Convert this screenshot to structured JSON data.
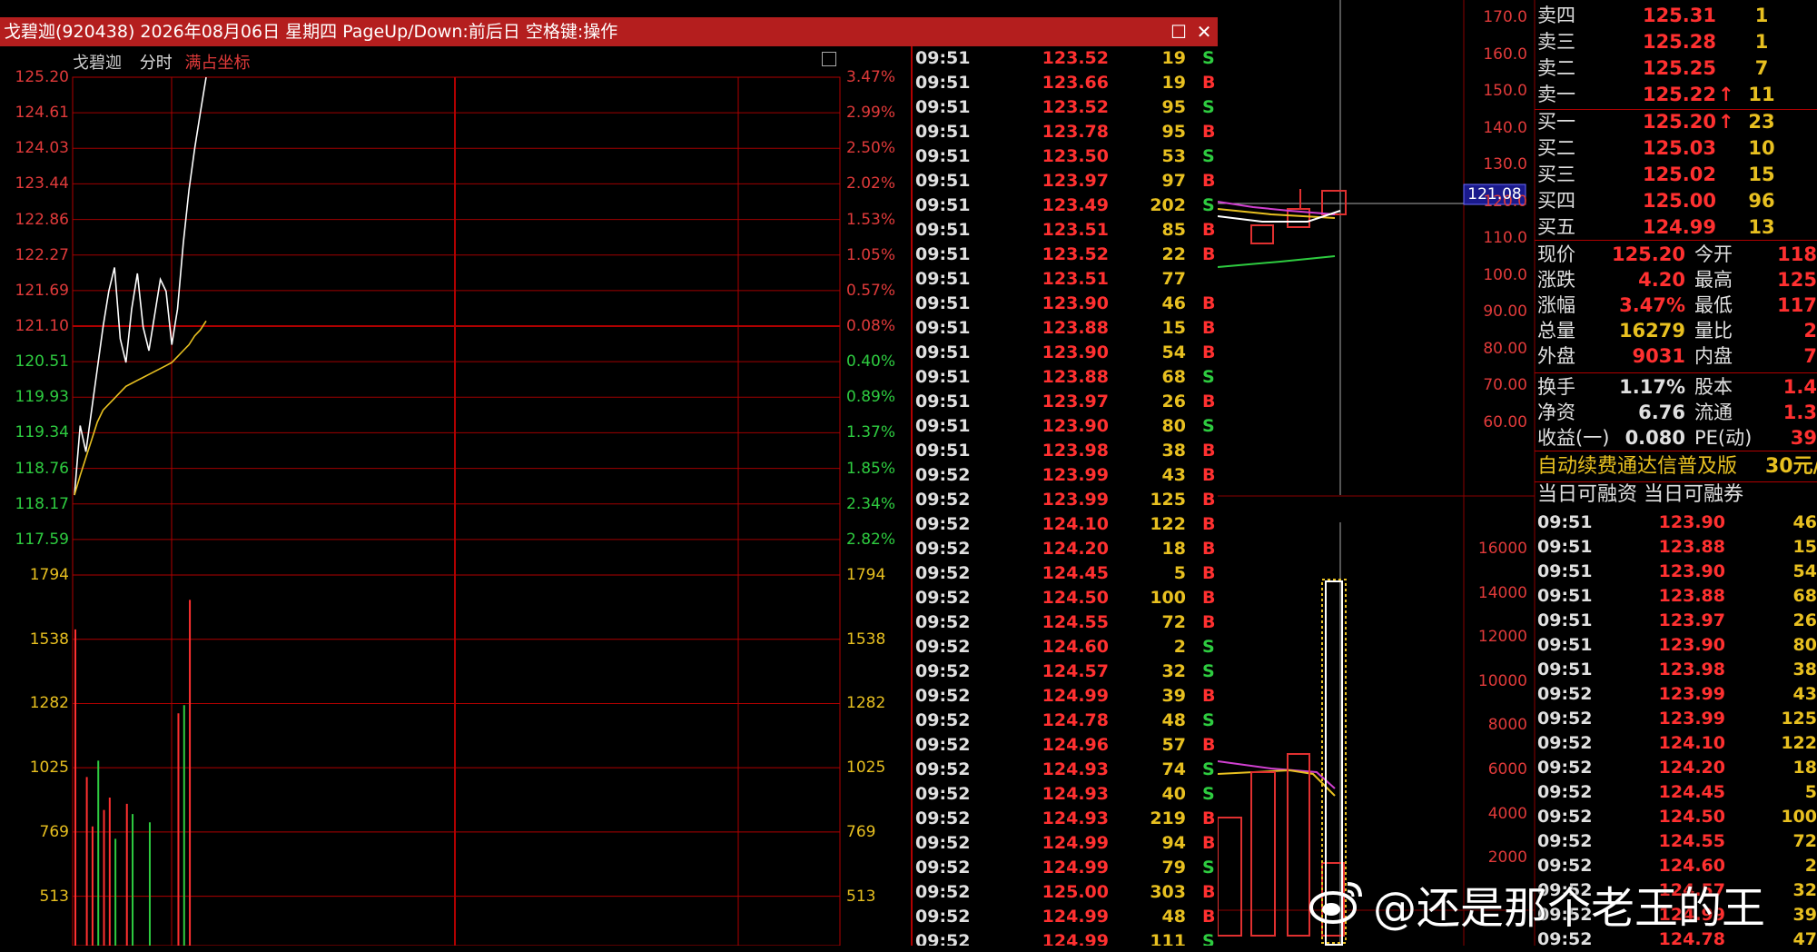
{
  "window": {
    "title": "戈碧迦(920438) 2026年08月06日 星期四 PageUp/Down:前后日 空格键:操作",
    "maximize_icon": "maximize-icon",
    "close_icon": "close-icon"
  },
  "chart_header": {
    "stock_name": "戈碧迦",
    "period": "分时",
    "mode": "满占坐标"
  },
  "price_ticks": [
    "125.20",
    "124.61",
    "124.03",
    "123.44",
    "122.86",
    "122.27",
    "121.69",
    "121.10",
    "120.51",
    "119.93",
    "119.34",
    "118.76",
    "118.17",
    "117.59"
  ],
  "pct_ticks": [
    "3.47%",
    "2.99%",
    "2.50%",
    "2.02%",
    "1.53%",
    "1.05%",
    "0.57%",
    "0.08%",
    "0.40%",
    "0.89%",
    "1.37%",
    "1.85%",
    "2.34%",
    "2.82%"
  ],
  "volume_ticks": [
    "1794",
    "1538",
    "1282",
    "1025",
    "769",
    "513"
  ],
  "right_axis_top": [
    "170.0",
    "160.0",
    "150.0",
    "140.0",
    "130.0",
    "120.0",
    "110.0",
    "100.0",
    "90.00",
    "80.00",
    "70.00",
    "60.00"
  ],
  "right_axis_bottom": [
    "16000",
    "14000",
    "12000",
    "10000",
    "8000",
    "6000",
    "4000",
    "2000"
  ],
  "crosshair_price": "121.08",
  "chart_data": {
    "type": "line",
    "title": "",
    "xlabel": "",
    "ylabel": "",
    "ylim": [
      117.59,
      125.2
    ],
    "series": [
      {
        "name": "",
        "color": "#ffffff",
        "values": [
          118.17,
          119.34,
          118.9,
          119.6,
          120.3,
          121.0,
          121.6,
          122.0,
          120.8,
          120.4,
          121.3,
          121.9,
          121.0,
          120.6,
          121.2,
          121.8,
          121.6,
          120.7,
          121.3,
          122.4,
          123.3,
          124.0,
          124.61,
          125.2
        ]
      },
      {
        "name": "",
        "color": "#e8c020",
        "values": [
          118.17,
          118.5,
          118.8,
          119.1,
          119.4,
          119.6,
          119.7,
          119.8,
          119.9,
          120.0,
          120.05,
          120.1,
          120.15,
          120.2,
          120.25,
          120.3,
          120.35,
          120.4,
          120.5,
          120.6,
          120.7,
          120.85,
          120.95,
          121.1
        ]
      }
    ],
    "volumes": [
      1538,
      0,
      820,
      580,
      900,
      660,
      720,
      520,
      0,
      690,
      640,
      0,
      0,
      600,
      0,
      0,
      0,
      0,
      1130,
      1170,
      1682
    ]
  },
  "trades_popup": [
    {
      "time": "09:51",
      "price": "123.52",
      "vol": "19",
      "side": "S"
    },
    {
      "time": "09:51",
      "price": "123.66",
      "vol": "19",
      "side": "B"
    },
    {
      "time": "09:51",
      "price": "123.52",
      "vol": "95",
      "side": "S"
    },
    {
      "time": "09:51",
      "price": "123.78",
      "vol": "95",
      "side": "B"
    },
    {
      "time": "09:51",
      "price": "123.50",
      "vol": "53",
      "side": "S"
    },
    {
      "time": "09:51",
      "price": "123.97",
      "vol": "97",
      "side": "B"
    },
    {
      "time": "09:51",
      "price": "123.49",
      "vol": "202",
      "side": "S"
    },
    {
      "time": "09:51",
      "price": "123.51",
      "vol": "85",
      "side": "B"
    },
    {
      "time": "09:51",
      "price": "123.52",
      "vol": "22",
      "side": "B"
    },
    {
      "time": "09:51",
      "price": "123.51",
      "vol": "77",
      "side": ""
    },
    {
      "time": "09:51",
      "price": "123.90",
      "vol": "46",
      "side": "B"
    },
    {
      "time": "09:51",
      "price": "123.88",
      "vol": "15",
      "side": "B"
    },
    {
      "time": "09:51",
      "price": "123.90",
      "vol": "54",
      "side": "B"
    },
    {
      "time": "09:51",
      "price": "123.88",
      "vol": "68",
      "side": "S"
    },
    {
      "time": "09:51",
      "price": "123.97",
      "vol": "26",
      "side": "B"
    },
    {
      "time": "09:51",
      "price": "123.90",
      "vol": "80",
      "side": "S"
    },
    {
      "time": "09:51",
      "price": "123.98",
      "vol": "38",
      "side": "B"
    },
    {
      "time": "09:52",
      "price": "123.99",
      "vol": "43",
      "side": "B"
    },
    {
      "time": "09:52",
      "price": "123.99",
      "vol": "125",
      "side": "B"
    },
    {
      "time": "09:52",
      "price": "124.10",
      "vol": "122",
      "side": "B"
    },
    {
      "time": "09:52",
      "price": "124.20",
      "vol": "18",
      "side": "B"
    },
    {
      "time": "09:52",
      "price": "124.45",
      "vol": "5",
      "side": "B"
    },
    {
      "time": "09:52",
      "price": "124.50",
      "vol": "100",
      "side": "B"
    },
    {
      "time": "09:52",
      "price": "124.55",
      "vol": "72",
      "side": "B"
    },
    {
      "time": "09:52",
      "price": "124.60",
      "vol": "2",
      "side": "S"
    },
    {
      "time": "09:52",
      "price": "124.57",
      "vol": "32",
      "side": "S"
    },
    {
      "time": "09:52",
      "price": "124.99",
      "vol": "39",
      "side": "B"
    },
    {
      "time": "09:52",
      "price": "124.78",
      "vol": "48",
      "side": "S"
    },
    {
      "time": "09:52",
      "price": "124.96",
      "vol": "57",
      "side": "B"
    },
    {
      "time": "09:52",
      "price": "124.93",
      "vol": "74",
      "side": "S"
    },
    {
      "time": "09:52",
      "price": "124.93",
      "vol": "40",
      "side": "S"
    },
    {
      "time": "09:52",
      "price": "124.93",
      "vol": "219",
      "side": "B"
    },
    {
      "time": "09:52",
      "price": "124.99",
      "vol": "94",
      "side": "B"
    },
    {
      "time": "09:52",
      "price": "124.99",
      "vol": "79",
      "side": "S"
    },
    {
      "time": "09:52",
      "price": "125.00",
      "vol": "303",
      "side": "B"
    },
    {
      "time": "09:52",
      "price": "124.99",
      "vol": "48",
      "side": "B"
    },
    {
      "time": "09:52",
      "price": "124.99",
      "vol": "111",
      "side": "S"
    }
  ],
  "order_book": [
    {
      "label": "卖四",
      "price": "125.31",
      "vol": "1",
      "arrow": ""
    },
    {
      "label": "卖三",
      "price": "125.28",
      "vol": "1",
      "arrow": ""
    },
    {
      "label": "卖二",
      "price": "125.25",
      "vol": "7",
      "arrow": ""
    },
    {
      "label": "卖一",
      "price": "125.22",
      "vol": "11",
      "arrow": "↑"
    },
    {
      "label": "买一",
      "price": "125.20",
      "vol": "23",
      "arrow": "↑"
    },
    {
      "label": "买二",
      "price": "125.03",
      "vol": "10",
      "arrow": ""
    },
    {
      "label": "买三",
      "price": "125.02",
      "vol": "15",
      "arrow": ""
    },
    {
      "label": "买四",
      "price": "125.00",
      "vol": "96",
      "arrow": ""
    },
    {
      "label": "买五",
      "price": "124.99",
      "vol": "13",
      "arrow": ""
    }
  ],
  "stock_info": [
    {
      "l1": "现价",
      "v1": "125.20",
      "c1": "red",
      "l2": "今开",
      "v2": "118"
    },
    {
      "l1": "涨跌",
      "v1": "4.20",
      "c1": "red",
      "l2": "最高",
      "v2": "125"
    },
    {
      "l1": "涨幅",
      "v1": "3.47%",
      "c1": "red",
      "l2": "最低",
      "v2": "117"
    },
    {
      "l1": "总量",
      "v1": "16279",
      "c1": "yel",
      "l2": "量比",
      "v2": "2"
    },
    {
      "l1": "外盘",
      "v1": "9031",
      "c1": "red",
      "l2": "内盘",
      "v2": "7"
    },
    {
      "l1": "换手",
      "v1": "1.17%",
      "c1": "wht",
      "l2": "股本",
      "v2": "1.4"
    },
    {
      "l1": "净资",
      "v1": "6.76",
      "c1": "wht",
      "l2": "流通",
      "v2": "1.3"
    },
    {
      "l1": "收益(一)",
      "v1": "0.080",
      "c1": "wht",
      "l2": "PE(动)",
      "v2": "39"
    }
  ],
  "promo": {
    "text": "自动续费通达信普及版",
    "price": "30元/"
  },
  "margin_line": "当日可融资 当日可融券",
  "trades_right": [
    {
      "time": "09:51",
      "price": "123.90",
      "vol": "46"
    },
    {
      "time": "09:51",
      "price": "123.88",
      "vol": "15"
    },
    {
      "time": "09:51",
      "price": "123.90",
      "vol": "54"
    },
    {
      "time": "09:51",
      "price": "123.88",
      "vol": "68"
    },
    {
      "time": "09:51",
      "price": "123.97",
      "vol": "26"
    },
    {
      "time": "09:51",
      "price": "123.90",
      "vol": "80"
    },
    {
      "time": "09:51",
      "price": "123.98",
      "vol": "38"
    },
    {
      "time": "09:52",
      "price": "123.99",
      "vol": "43"
    },
    {
      "time": "09:52",
      "price": "123.99",
      "vol": "125"
    },
    {
      "time": "09:52",
      "price": "124.10",
      "vol": "122"
    },
    {
      "time": "09:52",
      "price": "124.20",
      "vol": "18"
    },
    {
      "time": "09:52",
      "price": "124.45",
      "vol": "5"
    },
    {
      "time": "09:52",
      "price": "124.50",
      "vol": "100"
    },
    {
      "time": "09:52",
      "price": "124.55",
      "vol": "72"
    },
    {
      "time": "09:52",
      "price": "124.60",
      "vol": "2"
    },
    {
      "time": "09:52",
      "price": "124.57",
      "vol": "32"
    },
    {
      "time": "09:52",
      "price": "124.99",
      "vol": "39"
    },
    {
      "time": "09:52",
      "price": "124.78",
      "vol": "47"
    }
  ],
  "watermark": "@还是那个老王的王",
  "watermark_icon": "weibo-logo-icon",
  "colors": {
    "up": "#ff3030",
    "down": "#2ecc40",
    "volume": "#e8c020",
    "grid": "#b00000",
    "titlebar": "#b41e1e"
  }
}
